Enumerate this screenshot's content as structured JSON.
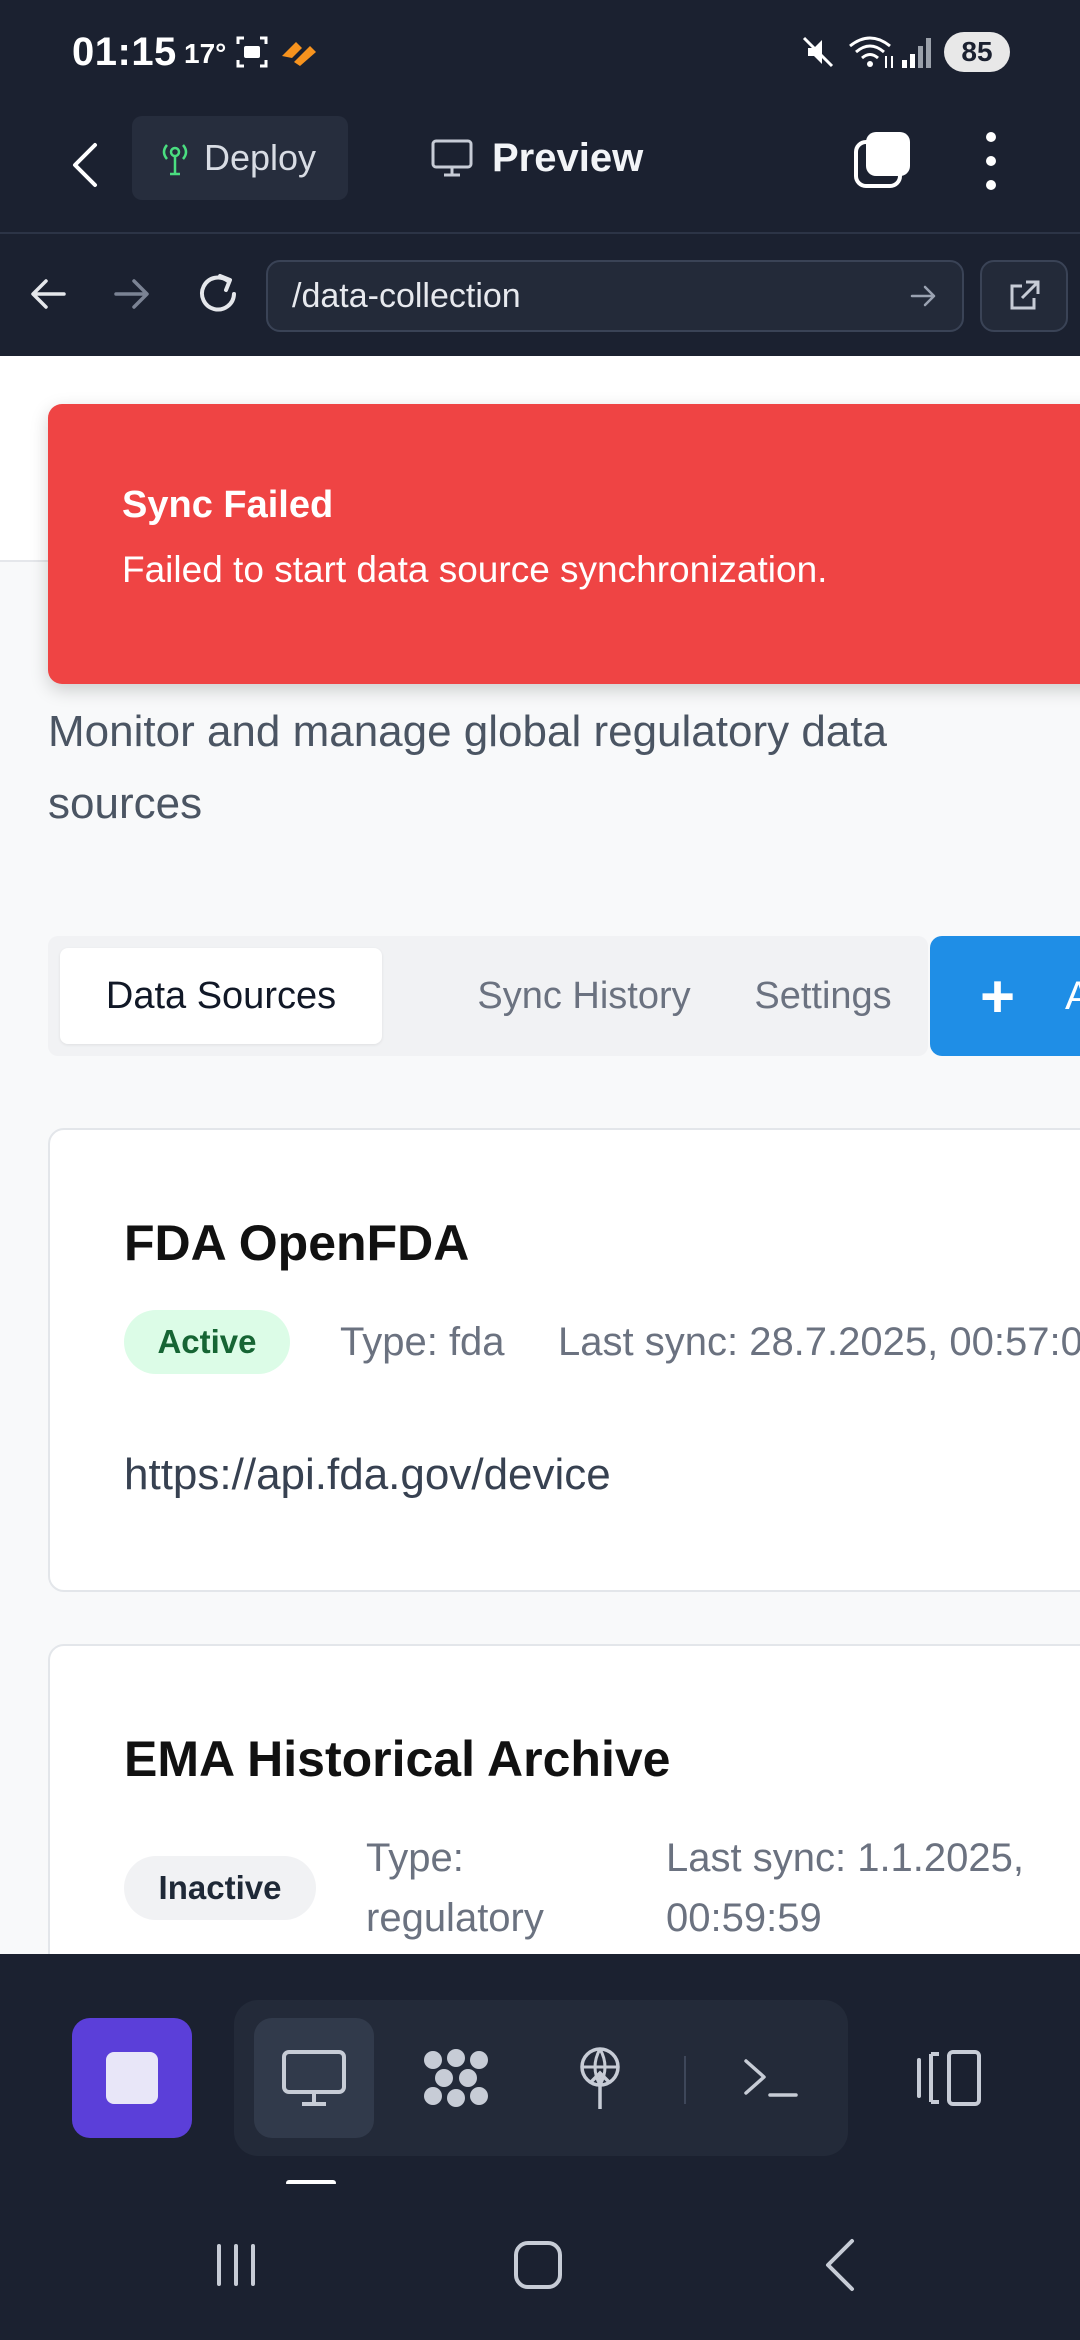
{
  "status_bar": {
    "time": "01:15",
    "temperature": "17°",
    "battery": "85"
  },
  "header": {
    "deploy_label": "Deploy",
    "preview_label": "Preview"
  },
  "browser": {
    "url": "/data-collection"
  },
  "toast": {
    "title": "Sync Failed",
    "message": "Failed to start data source synchronization."
  },
  "page": {
    "subtitle": "Monitor and manage global regulatory data sources",
    "tabs": [
      {
        "label": "Data Sources",
        "active": true
      },
      {
        "label": "Sync History",
        "active": false
      },
      {
        "label": "Settings",
        "active": false
      }
    ],
    "add_button": {
      "icon": "+",
      "label": "A"
    }
  },
  "data_sources": [
    {
      "name": "FDA OpenFDA",
      "status": "Active",
      "type": "Type: fda",
      "last_sync": "Last sync: 28.7.2025, 00:57:0",
      "url": "https://api.fda.gov/device"
    },
    {
      "name": "EMA Historical Archive",
      "status": "Inactive",
      "type_line1": "Type:",
      "type_line2": "regulatory",
      "last_sync_line1": "Last sync: 1.1.2025,",
      "last_sync_line2": "00:59:59"
    }
  ],
  "colors": {
    "chrome_bg": "#1b2130",
    "toast_bg": "#ef4444",
    "primary": "#1f8ee6",
    "stop_button": "#5b3fd9",
    "active_badge_bg": "#dcfce7",
    "active_badge_text": "#166534"
  }
}
